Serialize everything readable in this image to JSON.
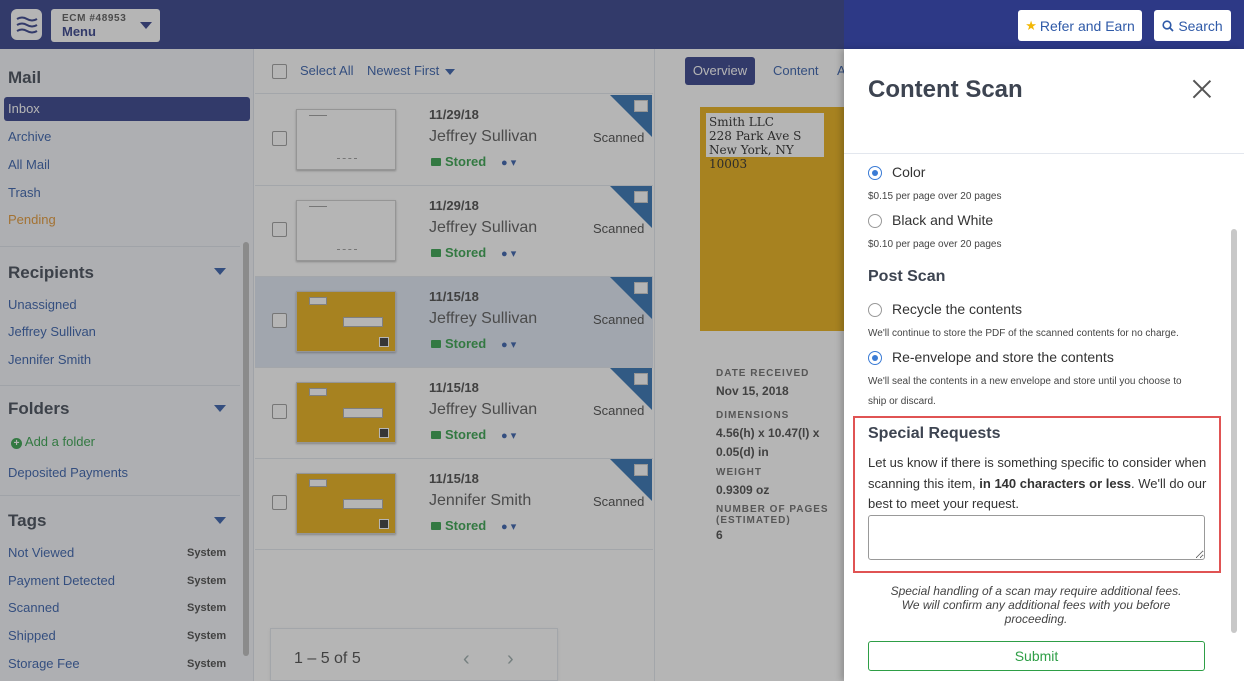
{
  "topbar": {
    "account": "ECM #48953",
    "menu_label": "Menu",
    "refer_label": "Refer and Earn",
    "search_label": "Search"
  },
  "sidebar": {
    "mail_heading": "Mail",
    "mail_items": [
      "Inbox",
      "Archive",
      "All Mail",
      "Trash",
      "Pending"
    ],
    "recipients_heading": "Recipients",
    "recipients": [
      "Unassigned",
      "Jeffrey Sullivan",
      "Jennifer Smith"
    ],
    "folders_heading": "Folders",
    "add_folder": "Add a folder",
    "folders": [
      "Deposited Payments"
    ],
    "tags_heading": "Tags",
    "tags": [
      {
        "label": "Not Viewed",
        "badge": "System"
      },
      {
        "label": "Payment Detected",
        "badge": "System"
      },
      {
        "label": "Scanned",
        "badge": "System"
      },
      {
        "label": "Shipped",
        "badge": "System"
      },
      {
        "label": "Storage Fee",
        "badge": "System"
      }
    ]
  },
  "list": {
    "select_all": "Select All",
    "sort": "Newest First",
    "rows": [
      {
        "date": "11/29/18",
        "name": "Jeffrey Sullivan",
        "status": "Stored",
        "scan": "Scanned",
        "thumb": "white"
      },
      {
        "date": "11/29/18",
        "name": "Jeffrey Sullivan",
        "status": "Stored",
        "scan": "Scanned",
        "thumb": "white"
      },
      {
        "date": "11/15/18",
        "name": "Jeffrey Sullivan",
        "status": "Stored",
        "scan": "Scanned",
        "thumb": "yellow"
      },
      {
        "date": "11/15/18",
        "name": "Jeffrey Sullivan",
        "status": "Stored",
        "scan": "Scanned",
        "thumb": "yellow"
      },
      {
        "date": "11/15/18",
        "name": "Jennifer Smith",
        "status": "Stored",
        "scan": "Scanned",
        "thumb": "yellow"
      }
    ],
    "pagination": "1 – 5 of 5"
  },
  "detail": {
    "tabs": [
      "Overview",
      "Content",
      "A"
    ],
    "envelope_lines": [
      "Smith LLC",
      "228 Park Ave S",
      "New York, NY 10003"
    ],
    "date_received_label": "DATE RECEIVED",
    "date_received": "Nov 15, 2018",
    "dimensions_label": "DIMENSIONS",
    "dimensions_1": "4.56(h) x 10.47(l) x",
    "dimensions_2": "0.05(d) in",
    "weight_label": "WEIGHT",
    "weight": "0.9309 oz",
    "pages_label_1": "NUMBER OF PAGES",
    "pages_label_2": "(ESTIMATED)",
    "pages": "6"
  },
  "modal": {
    "title": "Content Scan",
    "color_label": "Color",
    "color_note": "$0.15 per page over 20 pages",
    "bw_label": "Black and White",
    "bw_note": "$0.10 per page over 20 pages",
    "post_scan_title": "Post Scan",
    "recycle_label": "Recycle the contents",
    "recycle_note": "We'll continue to store the PDF of the scanned contents for no charge.",
    "reenvelope_label": "Re-envelope and store the contents",
    "reenvelope_note_1": "We'll seal the contents in a new envelope and store until you choose to",
    "reenvelope_note_2": "ship or discard.",
    "special_title": "Special Requests",
    "special_text_1": "Let us know if there is something specific to consider when scanning this item, ",
    "special_text_bold": "in 140 characters or less",
    "special_text_2": ". We'll do our best to meet your request.",
    "special_value": "",
    "fees_1": "Special handling of a scan may require additional fees.",
    "fees_2": "We will confirm any additional fees with you before proceeding.",
    "submit_label": "Submit"
  },
  "colors": {
    "brand": "#2d3986",
    "link": "#2f5aa8",
    "stored": "#2e9e46",
    "envelope": "#e8ad0f",
    "highlight": "#e05353",
    "pending": "#e3942e"
  },
  "icons": [
    "menu-waves-icon",
    "star-icon",
    "search-icon",
    "folder-icon",
    "tag-icon",
    "close-icon",
    "plus-circle-icon"
  ]
}
